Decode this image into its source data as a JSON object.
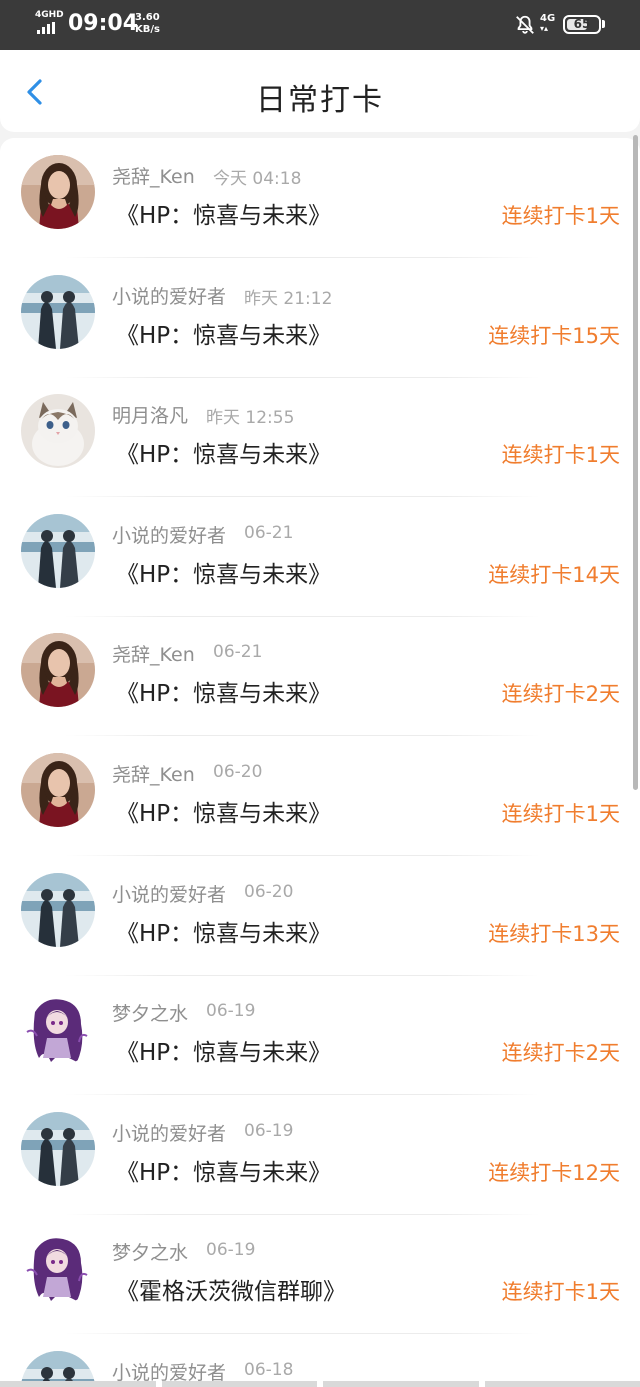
{
  "status_bar": {
    "network_label": "4GHD",
    "time": "09:04",
    "speed_value": "3.60",
    "speed_unit": "KB/s",
    "mobile_label": "4G",
    "battery": "65",
    "battery_level": 0.65,
    "icons": [
      "signal-icon",
      "bell-off-icon",
      "mobile-data-icon",
      "battery-icon"
    ]
  },
  "header": {
    "title": "日常打卡",
    "back_icon": "chevron-left-icon",
    "accent_color": "#2f8fe6"
  },
  "colors": {
    "streak": "#f07d2e",
    "name": "#8f8f8f",
    "time": "#a9a9a9",
    "title": "#222222"
  },
  "checkins": [
    {
      "user": "尧辞_Ken",
      "time": "今天 04:18",
      "book": "《HP：惊喜与未来》",
      "streak": "连续打卡1天",
      "avatar": "woman-portrait"
    },
    {
      "user": "小说的爱好者",
      "time": "昨天 21:12",
      "book": "《HP：惊喜与未来》",
      "streak": "连续打卡15天",
      "avatar": "two-figures"
    },
    {
      "user": "明月洛凡",
      "time": "昨天 12:55",
      "book": "《HP：惊喜与未来》",
      "streak": "连续打卡1天",
      "avatar": "cat"
    },
    {
      "user": "小说的爱好者",
      "time": "06-21",
      "book": "《HP：惊喜与未来》",
      "streak": "连续打卡14天",
      "avatar": "two-figures"
    },
    {
      "user": "尧辞_Ken",
      "time": "06-21",
      "book": "《HP：惊喜与未来》",
      "streak": "连续打卡2天",
      "avatar": "woman-portrait"
    },
    {
      "user": "尧辞_Ken",
      "time": "06-20",
      "book": "《HP：惊喜与未来》",
      "streak": "连续打卡1天",
      "avatar": "woman-portrait"
    },
    {
      "user": "小说的爱好者",
      "time": "06-20",
      "book": "《HP：惊喜与未来》",
      "streak": "连续打卡13天",
      "avatar": "two-figures"
    },
    {
      "user": "梦夕之水",
      "time": "06-19",
      "book": "《HP：惊喜与未来》",
      "streak": "连续打卡2天",
      "avatar": "anime-girl"
    },
    {
      "user": "小说的爱好者",
      "time": "06-19",
      "book": "《HP：惊喜与未来》",
      "streak": "连续打卡12天",
      "avatar": "two-figures"
    },
    {
      "user": "梦夕之水",
      "time": "06-19",
      "book": "《霍格沃茨微信群聊》",
      "streak": "连续打卡1天",
      "avatar": "anime-girl"
    },
    {
      "user": "小说的爱好者",
      "time": "06-18",
      "book": "",
      "streak": "",
      "avatar": "two-figures"
    }
  ]
}
